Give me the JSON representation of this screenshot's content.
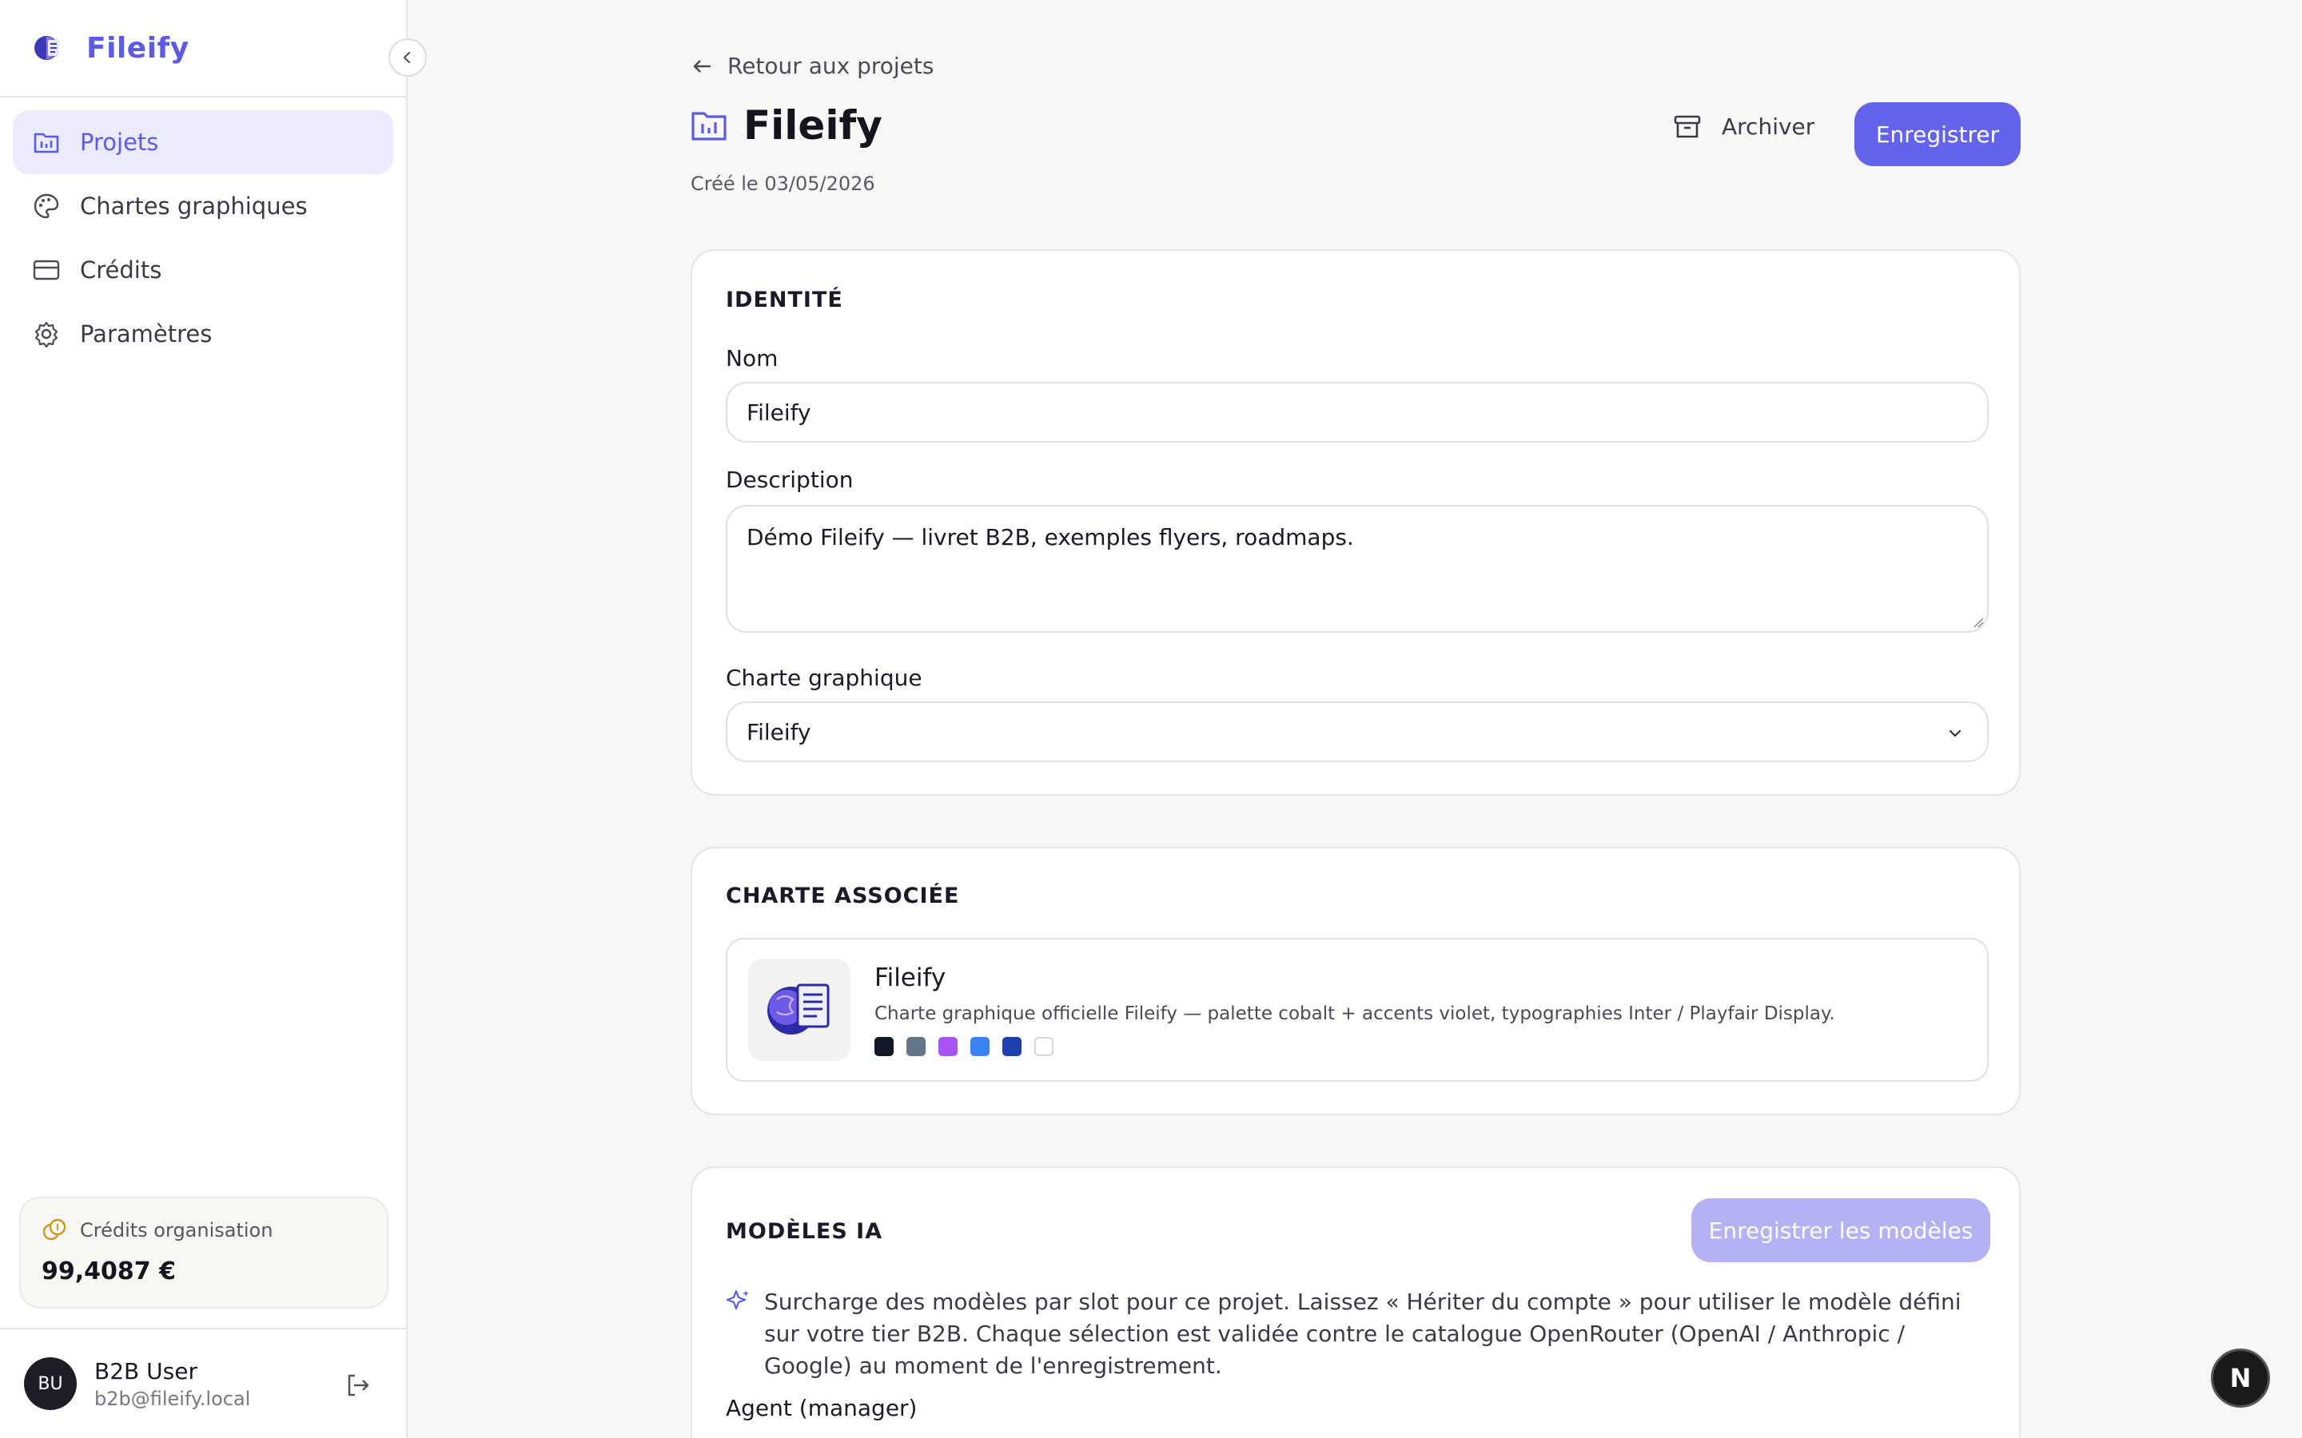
{
  "sidebar": {
    "brand": "Fileify",
    "nav": [
      {
        "label": "Projets",
        "icon": "folder-chart-icon",
        "active": true
      },
      {
        "label": "Chartes graphiques",
        "icon": "palette-icon",
        "active": false
      },
      {
        "label": "Crédits",
        "icon": "credit-card-icon",
        "active": false
      },
      {
        "label": "Paramètres",
        "icon": "gear-icon",
        "active": false
      }
    ],
    "credits": {
      "title": "Crédits organisation",
      "value": "99,4087 €"
    },
    "user": {
      "initials": "BU",
      "name": "B2B User",
      "email": "b2b@fileify.local"
    }
  },
  "header": {
    "back_label": "Retour aux projets",
    "title": "Fileify",
    "created": "Créé le 03/05/2026",
    "archive_label": "Archiver",
    "save_label": "Enregistrer"
  },
  "identity": {
    "section_title": "IDENTITÉ",
    "name_label": "Nom",
    "name_value": "Fileify",
    "description_label": "Description",
    "description_value": "Démo Fileify — livret B2B, exemples flyers, roadmaps.",
    "charte_label": "Charte graphique",
    "charte_value": "Fileify"
  },
  "charte": {
    "section_title": "CHARTE ASSOCIÉE",
    "name": "Fileify",
    "description": "Charte graphique officielle Fileify — palette cobalt + accents violet, typographies Inter / Playfair Display.",
    "swatches": [
      "#111827",
      "#64748b",
      "#a855f7",
      "#3b82f6",
      "#1e40af",
      "#ffffff"
    ]
  },
  "models": {
    "section_title": "MODÈLES IA",
    "save_models_label": "Enregistrer les modèles",
    "note": "Surcharge des modèles par slot pour ce projet. Laissez « Hériter du compte » pour utiliser le modèle défini sur votre tier B2B. Chaque sélection est validée contre le catalogue OpenRouter (OpenAI / Anthropic / Google) au moment de l'enregistrement.",
    "agent_label": "Agent (manager)"
  },
  "colors": {
    "accent": "#6363ec",
    "accent_light": "#ecebfd",
    "disabled_button": "#b4b1f5"
  },
  "fab_label": "N"
}
